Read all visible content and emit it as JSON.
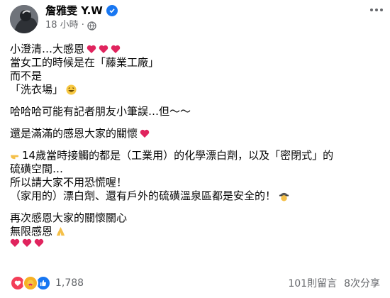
{
  "post": {
    "author": "詹雅雯 Y.W",
    "time": "18 小時",
    "dot": "·",
    "lines": [
      "小澄清…大感恩",
      "當女工的時候是在「藤業工廠」",
      "而不是",
      "「洗衣場」",
      "哈哈哈可能有記者朋友小筆誤…但～～",
      "還是滿滿的感恩大家的關懷",
      "14歲當時接觸的都是（工業用）的化學漂白劑，以及「密閉式」的",
      "硫磺空間…",
      "所以請大家不用恐慌喔！",
      "（家用的）漂白劑、還有戶外的硫磺溫泉區都是安全的！",
      "再次感恩大家的關懷關心",
      "無限感恩"
    ],
    "icons": {
      "heart": "red-heart-icon",
      "smile": "grinning-face-icon",
      "point": "backhand-index-pointing-right-icon",
      "detective": "detective-icon",
      "pray": "folded-hands-icon"
    },
    "colors": {
      "heart": "#e0245e",
      "verified": "#1877f2",
      "muted": "#65676b"
    }
  },
  "footer": {
    "reaction_count": "1,788",
    "comments": "101則留言",
    "shares": "8次分享"
  }
}
